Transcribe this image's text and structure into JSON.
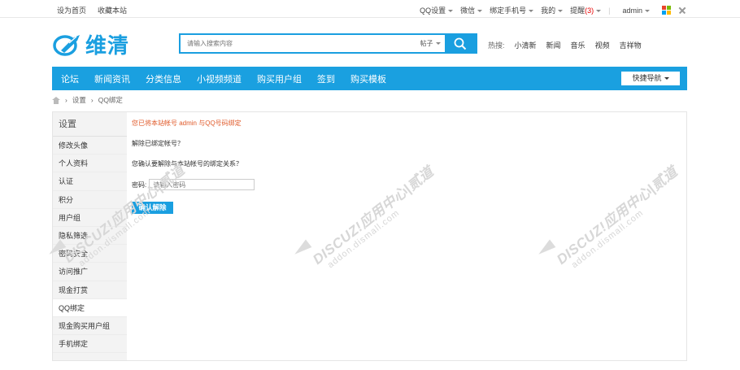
{
  "topbar": {
    "set_home": "设为首页",
    "bookmark": "收藏本站",
    "qq_settings": "QQ设置",
    "wechat": "微信",
    "bind_phone": "绑定手机号",
    "mine": "我的",
    "notice": "提醒",
    "notice_count": "(3)",
    "divider": "|",
    "username": "admin",
    "win_colors": [
      "#e8452c",
      "#7cbb00",
      "#00a1f1",
      "#ffbb00"
    ]
  },
  "header": {
    "logo_text": "维清",
    "search_placeholder": "请输入搜索内容",
    "search_scope": "帖子",
    "hot_label": "热搜:",
    "hot_items": [
      "小清新",
      "新闻",
      "音乐",
      "视频",
      "吉祥物"
    ]
  },
  "nav": {
    "items": [
      "论坛",
      "新闻资讯",
      "分类信息",
      "小视频频道",
      "购买用户组",
      "签到",
      "购买模板"
    ],
    "quick_nav": "快捷导航"
  },
  "breadcrumb": {
    "items": [
      "设置",
      "QQ绑定"
    ]
  },
  "sidebar": {
    "title": "设置",
    "items": [
      "修改头像",
      "个人资料",
      "认证",
      "积分",
      "用户组",
      "隐私筛选",
      "密码安全",
      "访问推广",
      "现金打赏",
      "QQ绑定",
      "现金购买用户组",
      "手机绑定"
    ],
    "active": "QQ绑定"
  },
  "content": {
    "bind_info": "您已将本站帐号 admin 与QQ号码绑定",
    "unbound_title": "解除已绑定帐号？",
    "confirm_text": "您确认要解除与本站帐号的绑定关系？",
    "password_label": "密码:",
    "password_placeholder": "请输入密码",
    "confirm_button": "确认解除"
  },
  "watermark": {
    "line1": "DISCUZ!应用中心|贰道",
    "line2": "addon.dismall.com"
  },
  "colors": {
    "accent": "#1a9fe0",
    "warning_text": "#e05a2a",
    "notice_red": "#e60000"
  }
}
